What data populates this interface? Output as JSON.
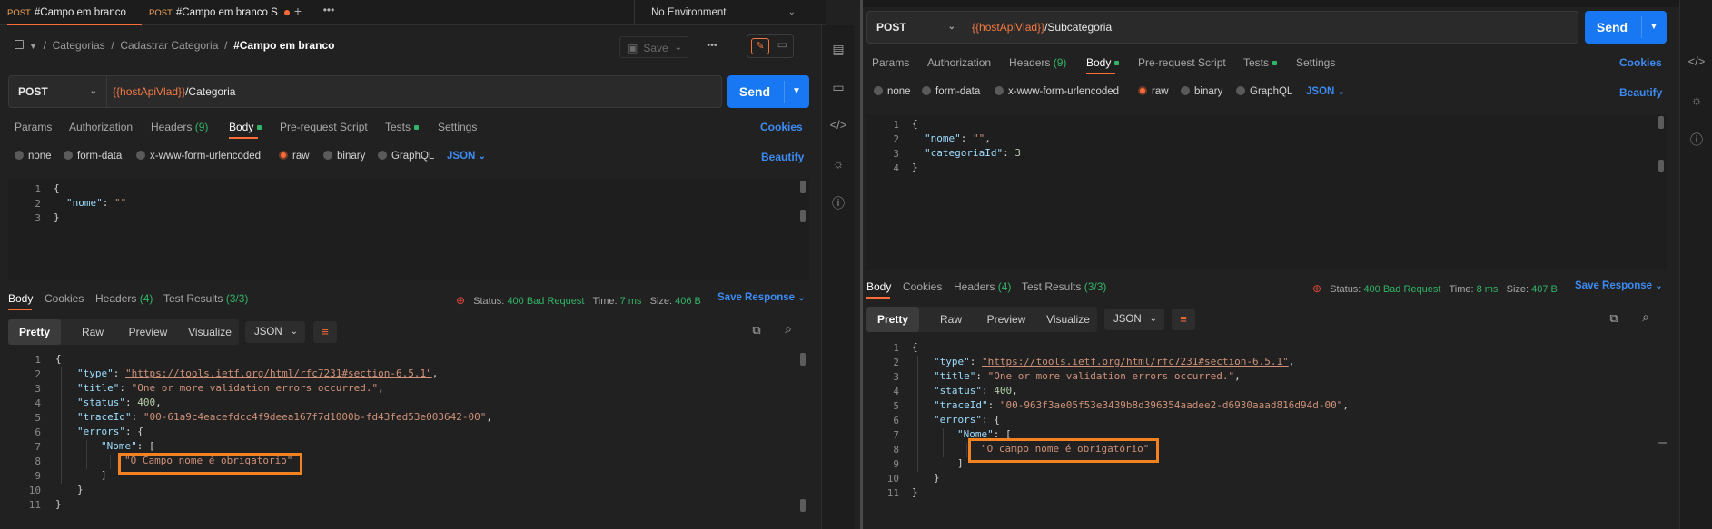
{
  "left": {
    "tabs": [
      {
        "method": "POST",
        "title": "#Campo em branco"
      },
      {
        "method": "POST",
        "title": "#Campo em branco S"
      }
    ],
    "new_tab_icon": "plus-icon",
    "more_tabs_icon": "ellipsis-icon",
    "environment": "No Environment",
    "breadcrumb": {
      "item1": "Categorias",
      "sep1": "/",
      "item2": "Cadastrar Categoria",
      "sep2": "/",
      "current": "#Campo em branco"
    },
    "save_label": "Save",
    "request": {
      "method": "POST",
      "url_var": "{{hostApiVlad}}",
      "url_path": "/Categoria",
      "send_label": "Send"
    },
    "req_tabs": {
      "params": "Params",
      "authorization": "Authorization",
      "headers": "Headers",
      "headers_count": "(9)",
      "body": "Body",
      "prerequest": "Pre-request Script",
      "tests": "Tests",
      "settings": "Settings",
      "cookies": "Cookies"
    },
    "body_types": {
      "none": "none",
      "formdata": "form-data",
      "urlencoded": "x-www-form-urlencoded",
      "raw": "raw",
      "binary": "binary",
      "graphql": "GraphQL",
      "format": "JSON",
      "beautify": "Beautify"
    },
    "req_body": [
      {
        "n": "1",
        "t": "{"
      },
      {
        "n": "2",
        "key": "\"nome\"",
        "colon": ": ",
        "val": "\"\""
      },
      {
        "n": "3",
        "t": "}"
      }
    ],
    "resp_tabs": {
      "body": "Body",
      "cookies": "Cookies",
      "headers": "Headers",
      "headers_count": "(4)",
      "tests": "Test Results",
      "tests_count": "(3/3)"
    },
    "status": {
      "status_label": "Status:",
      "status_value": "400 Bad Request",
      "time_label": "Time:",
      "time_value": "7 ms",
      "size_label": "Size:",
      "size_value": "406 B",
      "save_response": "Save Response"
    },
    "view": {
      "pretty": "Pretty",
      "raw": "Raw",
      "preview": "Preview",
      "visualize": "Visualize",
      "format": "JSON"
    },
    "resp_body": {
      "l1": "{",
      "type_key": "\"type\"",
      "type_val": "\"https://tools.ietf.org/html/rfc7231#section-6.5.1\"",
      "title_key": "\"title\"",
      "title_val": "\"One or more validation errors occurred.\"",
      "status_key": "\"status\"",
      "status_val": "400",
      "trace_key": "\"traceId\"",
      "trace_val": "\"00-61a9c4eacefdcc4f9deea167f7d1000b-fd43fed53e003642-00\"",
      "errors_key": "\"errors\"",
      "nome_key": "\"Nome\"",
      "msg": "\"O Campo nome é obrigatorio\"",
      "close_arr": "]",
      "close_obj": "}",
      "close_root": "}"
    }
  },
  "right": {
    "request": {
      "method": "POST",
      "url_var": "{{hostApiVlad}}",
      "url_path": "/Subcategoria",
      "send_label": "Send"
    },
    "req_tabs": {
      "params": "Params",
      "authorization": "Authorization",
      "headers": "Headers",
      "headers_count": "(9)",
      "body": "Body",
      "prerequest": "Pre-request Script",
      "tests": "Tests",
      "settings": "Settings",
      "cookies": "Cookies"
    },
    "body_types": {
      "none": "none",
      "formdata": "form-data",
      "urlencoded": "x-www-form-urlencoded",
      "raw": "raw",
      "binary": "binary",
      "graphql": "GraphQL",
      "format": "JSON",
      "beautify": "Beautify"
    },
    "req_body": {
      "l1": "{",
      "nome_key": "\"nome\"",
      "nome_val": "\"\"",
      "cat_key": "\"categoriaId\"",
      "cat_val": "3",
      "l4": "}"
    },
    "resp_tabs": {
      "body": "Body",
      "cookies": "Cookies",
      "headers": "Headers",
      "headers_count": "(4)",
      "tests": "Test Results",
      "tests_count": "(3/3)"
    },
    "status": {
      "status_label": "Status:",
      "status_value": "400 Bad Request",
      "time_label": "Time:",
      "time_value": "8 ms",
      "size_label": "Size:",
      "size_value": "407 B",
      "save_response": "Save Response"
    },
    "view": {
      "pretty": "Pretty",
      "raw": "Raw",
      "preview": "Preview",
      "visualize": "Visualize",
      "format": "JSON"
    },
    "resp_body": {
      "l1": "{",
      "type_key": "\"type\"",
      "type_val": "\"https://tools.ietf.org/html/rfc7231#section-6.5.1\"",
      "title_key": "\"title\"",
      "title_val": "\"One or more validation errors occurred.\"",
      "status_key": "\"status\"",
      "status_val": "400",
      "trace_key": "\"traceId\"",
      "trace_val": "\"00-963f3ae05f53e3439b8d396354aadee2-d6930aaad816d94d-00\"",
      "errors_key": "\"errors\"",
      "nome_key": "\"Nome\"",
      "msg": "\"O campo nome é obrigatório\"",
      "close_arr": "]",
      "close_obj": "}",
      "close_root": "}"
    }
  },
  "colors": {
    "accent": "#ff6c37",
    "send": "#1877f2",
    "highlight": "#f58220",
    "ok_green": "#33b466"
  }
}
